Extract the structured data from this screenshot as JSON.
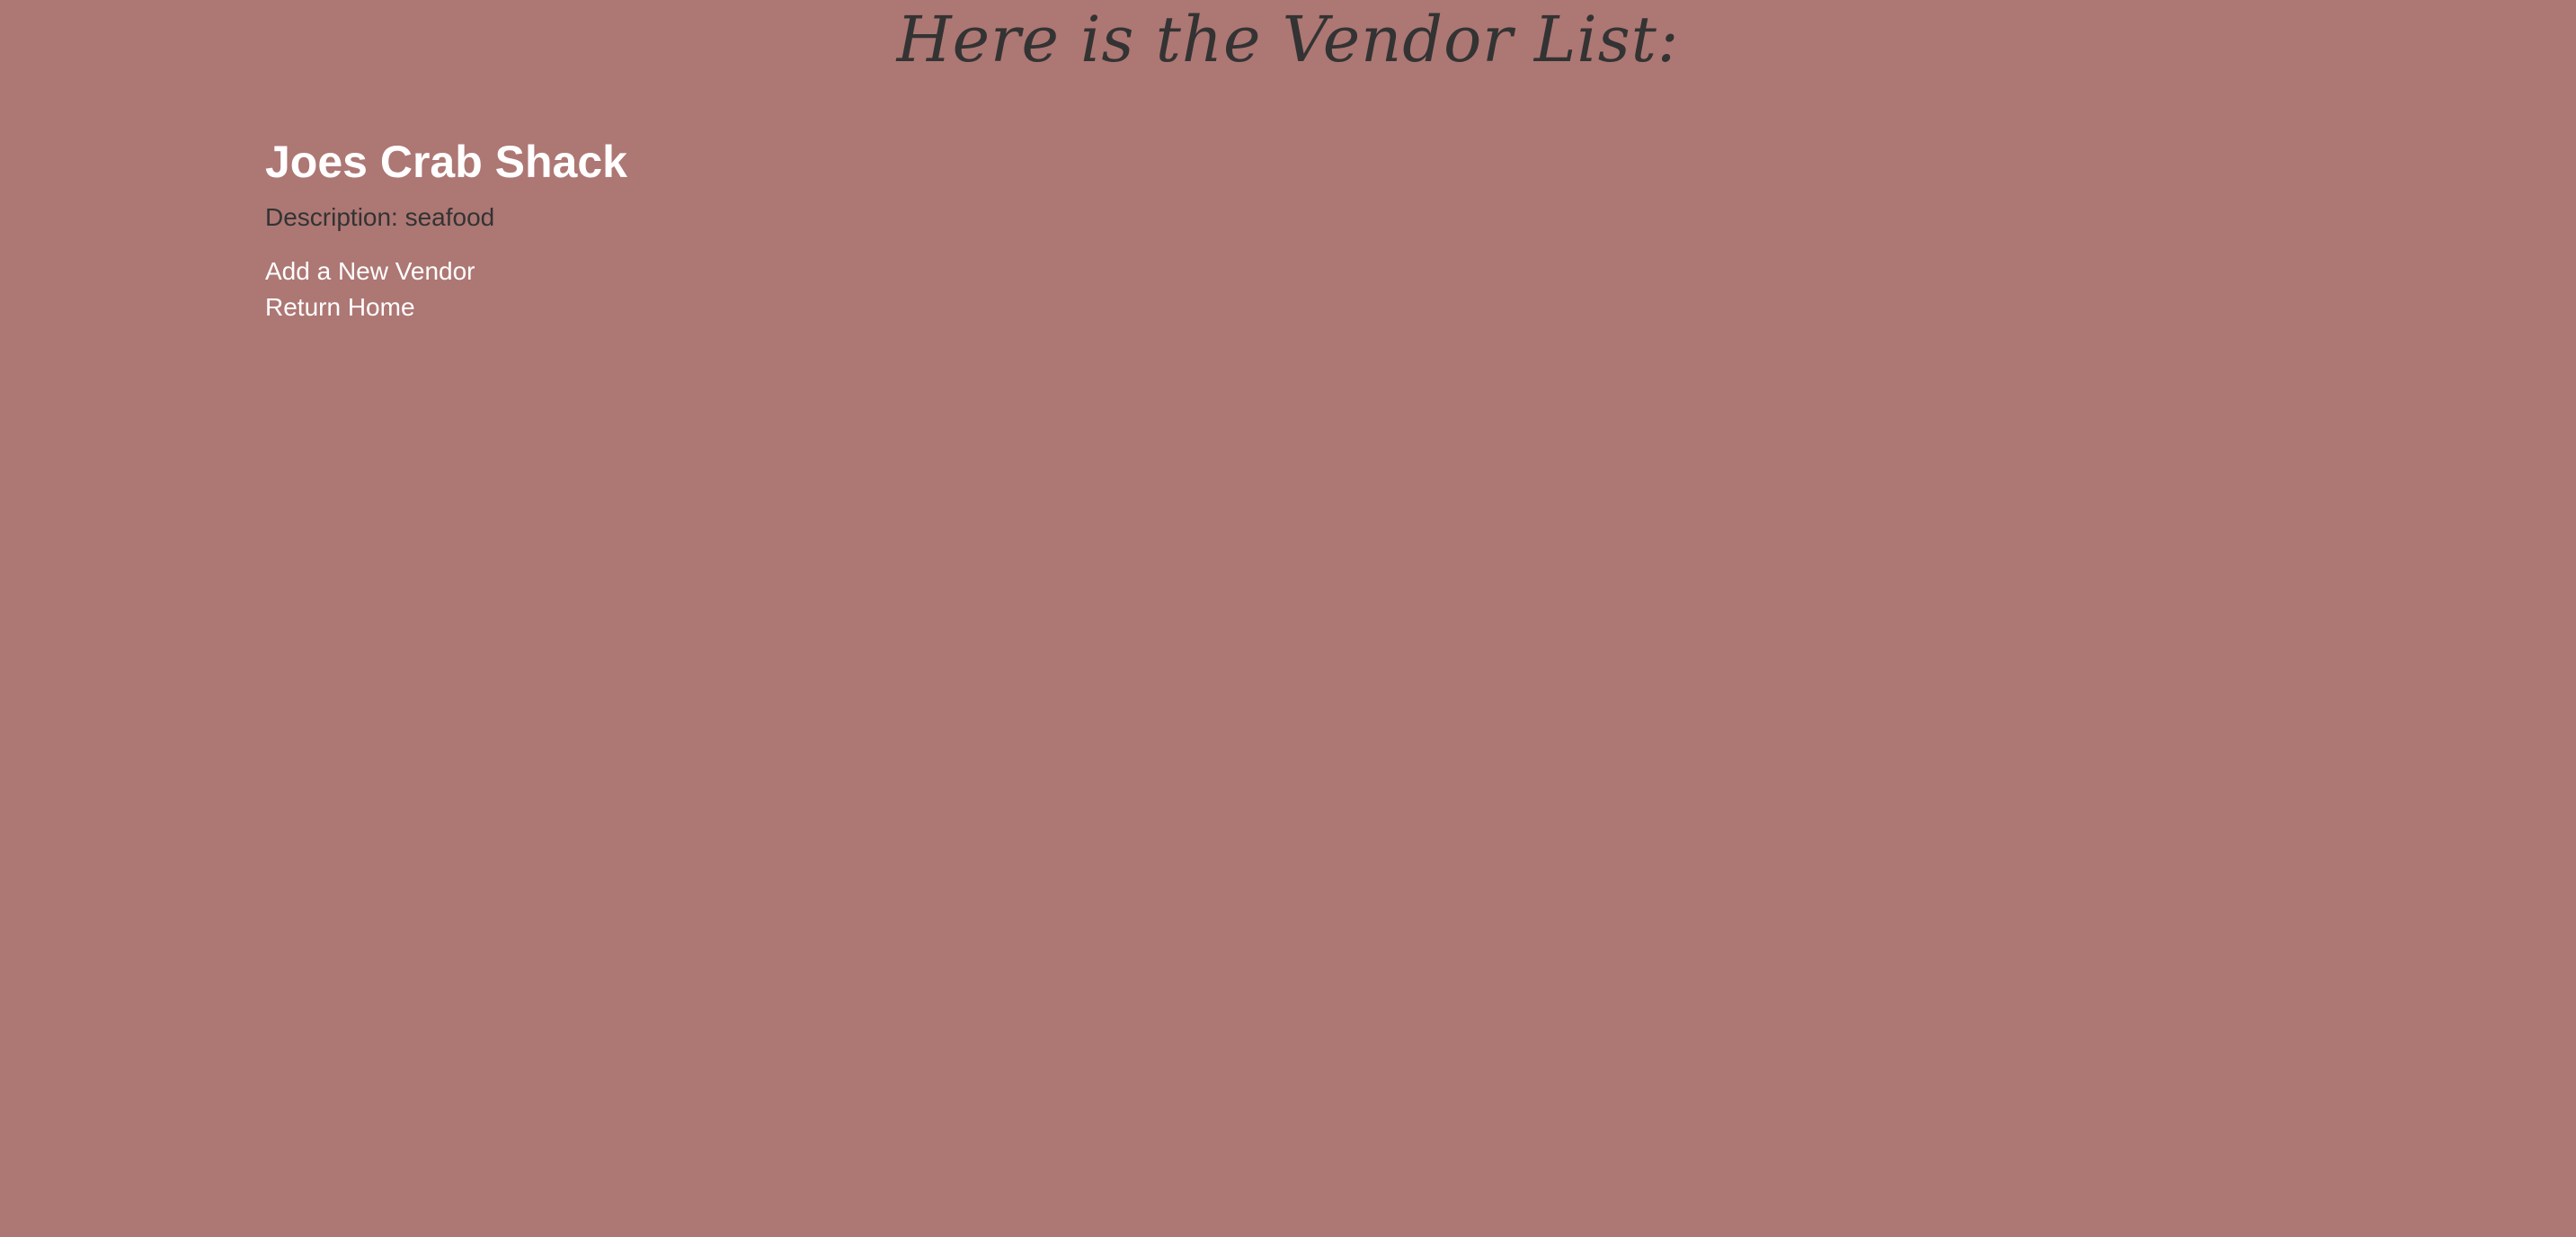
{
  "header": {
    "title": "Here is the Vendor List:"
  },
  "vendors": [
    {
      "name": "Joes Crab Shack",
      "description": "Description: seafood"
    }
  ],
  "links": {
    "add_vendor": "Add a New Vendor",
    "return_home": "Return Home"
  },
  "colors": {
    "background": "#ad7774",
    "heading_text": "#333333",
    "link_text": "#ffffff"
  }
}
